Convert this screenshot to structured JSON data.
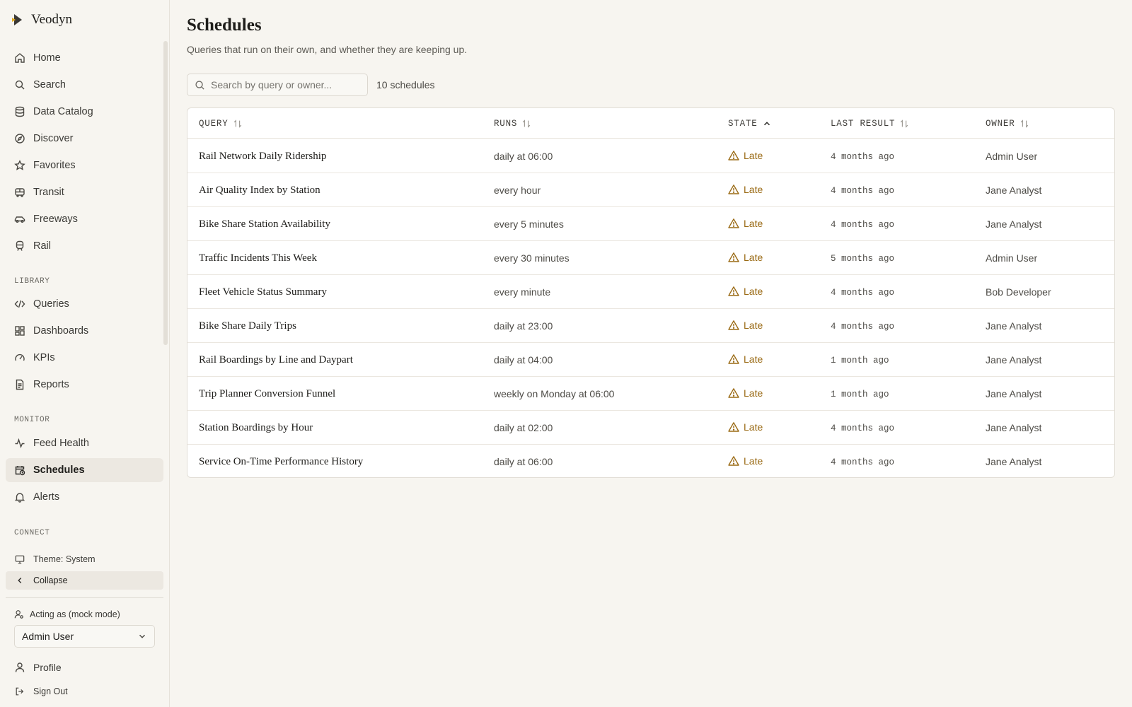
{
  "app": {
    "name": "Veodyn"
  },
  "sidebar": {
    "nav": [
      {
        "label": "Home",
        "icon": "home-icon"
      },
      {
        "label": "Search",
        "icon": "search-icon"
      },
      {
        "label": "Data Catalog",
        "icon": "database-icon"
      },
      {
        "label": "Discover",
        "icon": "compass-icon"
      },
      {
        "label": "Favorites",
        "icon": "star-icon"
      },
      {
        "label": "Transit",
        "icon": "bus-icon"
      },
      {
        "label": "Freeways",
        "icon": "car-icon"
      },
      {
        "label": "Rail",
        "icon": "train-icon"
      }
    ],
    "library_label": "LIBRARY",
    "library": [
      {
        "label": "Queries",
        "icon": "code-icon"
      },
      {
        "label": "Dashboards",
        "icon": "dashboard-icon"
      },
      {
        "label": "KPIs",
        "icon": "gauge-icon"
      },
      {
        "label": "Reports",
        "icon": "file-text-icon"
      }
    ],
    "monitor_label": "MONITOR",
    "monitor": [
      {
        "label": "Feed Health",
        "icon": "activity-icon"
      },
      {
        "label": "Schedules",
        "icon": "calendar-clock-icon",
        "active": true
      },
      {
        "label": "Alerts",
        "icon": "bell-icon"
      }
    ],
    "connect_label": "CONNECT",
    "theme_label": "Theme: System",
    "collapse_label": "Collapse",
    "acting_label": "Acting as (mock mode)",
    "acting_user": "Admin User",
    "profile_label": "Profile",
    "signout_label": "Sign Out"
  },
  "main": {
    "title": "Schedules",
    "subtitle": "Queries that run on their own, and whether they are keeping up.",
    "search_placeholder": "Search by query or owner...",
    "count_text": "10 schedules",
    "columns": {
      "query": "QUERY",
      "runs": "RUNS",
      "state": "STATE",
      "last_result": "LAST RESULT",
      "owner": "OWNER"
    },
    "rows": [
      {
        "query": "Rail Network Daily Ridership",
        "runs": "daily at 06:00",
        "state": "Late",
        "last": "4 months ago",
        "owner": "Admin User"
      },
      {
        "query": "Air Quality Index by Station",
        "runs": "every hour",
        "state": "Late",
        "last": "4 months ago",
        "owner": "Jane Analyst"
      },
      {
        "query": "Bike Share Station Availability",
        "runs": "every 5 minutes",
        "state": "Late",
        "last": "4 months ago",
        "owner": "Jane Analyst"
      },
      {
        "query": "Traffic Incidents This Week",
        "runs": "every 30 minutes",
        "state": "Late",
        "last": "5 months ago",
        "owner": "Admin User"
      },
      {
        "query": "Fleet Vehicle Status Summary",
        "runs": "every minute",
        "state": "Late",
        "last": "4 months ago",
        "owner": "Bob Developer"
      },
      {
        "query": "Bike Share Daily Trips",
        "runs": "daily at 23:00",
        "state": "Late",
        "last": "4 months ago",
        "owner": "Jane Analyst"
      },
      {
        "query": "Rail Boardings by Line and Daypart",
        "runs": "daily at 04:00",
        "state": "Late",
        "last": "1 month ago",
        "owner": "Jane Analyst"
      },
      {
        "query": "Trip Planner Conversion Funnel",
        "runs": "weekly on Monday at 06:00",
        "state": "Late",
        "last": "1 month ago",
        "owner": "Jane Analyst"
      },
      {
        "query": "Station Boardings by Hour",
        "runs": "daily at 02:00",
        "state": "Late",
        "last": "4 months ago",
        "owner": "Jane Analyst"
      },
      {
        "query": "Service On-Time Performance History",
        "runs": "daily at 06:00",
        "state": "Late",
        "last": "4 months ago",
        "owner": "Jane Analyst"
      }
    ]
  },
  "colors": {
    "background": "#f7f5f0",
    "late": "#9a6a14",
    "active_nav": "#ece8e1"
  }
}
